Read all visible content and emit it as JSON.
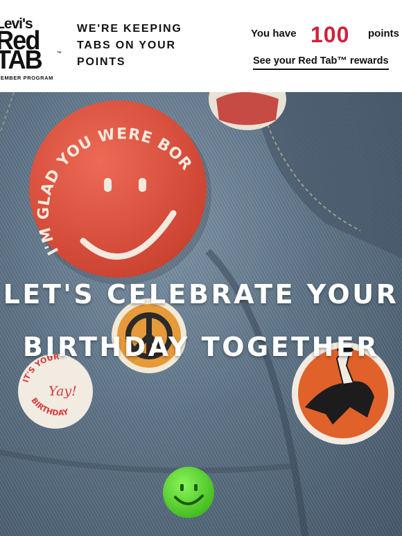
{
  "header": {
    "logo": {
      "brand": "Levi's",
      "line1": "Red",
      "line2": "TAB",
      "trademark": "™",
      "program": "MEMBER PROGRAM"
    },
    "tagline": "WE'RE KEEPING TABS ON YOUR POINTS",
    "points": {
      "prefix": "You have",
      "value": "100",
      "suffix": "points",
      "rewards_link": "See your Red Tab™ rewards"
    }
  },
  "hero": {
    "headline_line1": "LET'S CELEBRATE YOUR",
    "headline_line2": "BIRTHDAY TOGETHER",
    "pins": {
      "smiley_text": "I'M GLAD YOU WERE BORN",
      "birthday_top": "IT'S YOUR",
      "birthday_mid": "Yay!",
      "birthday_bottom": "BIRTHDAY"
    }
  },
  "colors": {
    "accent_red": "#d0213a",
    "denim": "#5d7386",
    "pin_red": "#e2543f",
    "pin_orange": "#e0612a",
    "pin_green": "#5fe12e"
  }
}
